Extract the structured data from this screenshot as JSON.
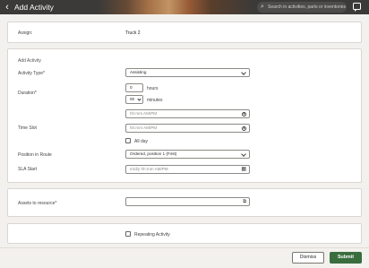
{
  "header": {
    "title": "Add Activity",
    "search_placeholder": "Search in activities, parts or inventories"
  },
  "assign": {
    "label": "Assign:",
    "value": "Truck 2"
  },
  "form": {
    "section_title": "Add Activity",
    "activity_type": {
      "label": "Activity Type*",
      "value": "Assisting"
    },
    "duration": {
      "label": "Duration*",
      "hours_value": "0",
      "hours_label": "hours",
      "minutes_value": "00",
      "minutes_label": "minutes"
    },
    "time_field_1": {
      "placeholder": "hh:mm AM/PM"
    },
    "time_slot": {
      "label": "Time Slot",
      "placeholder": "hh:mm AM/PM"
    },
    "all_day": {
      "label": "All day",
      "checked": false
    },
    "position_in_route": {
      "label": "Position in Route",
      "value": "Ordered, position 1 (First)"
    },
    "sla_start": {
      "label": "SLA Start",
      "placeholder": "m/d/y hh:mm AM/PM"
    }
  },
  "assets": {
    "label": "Assets to resource*",
    "value": ""
  },
  "repeating": {
    "label": "Repeating Activity",
    "checked": false
  },
  "footer": {
    "dismiss_label": "Dismiss",
    "submit_label": "Submit"
  },
  "colors": {
    "header_bg": "#3b3a38",
    "submit_bg": "#3a6d3e",
    "page_bg": "#f3f1ee"
  }
}
